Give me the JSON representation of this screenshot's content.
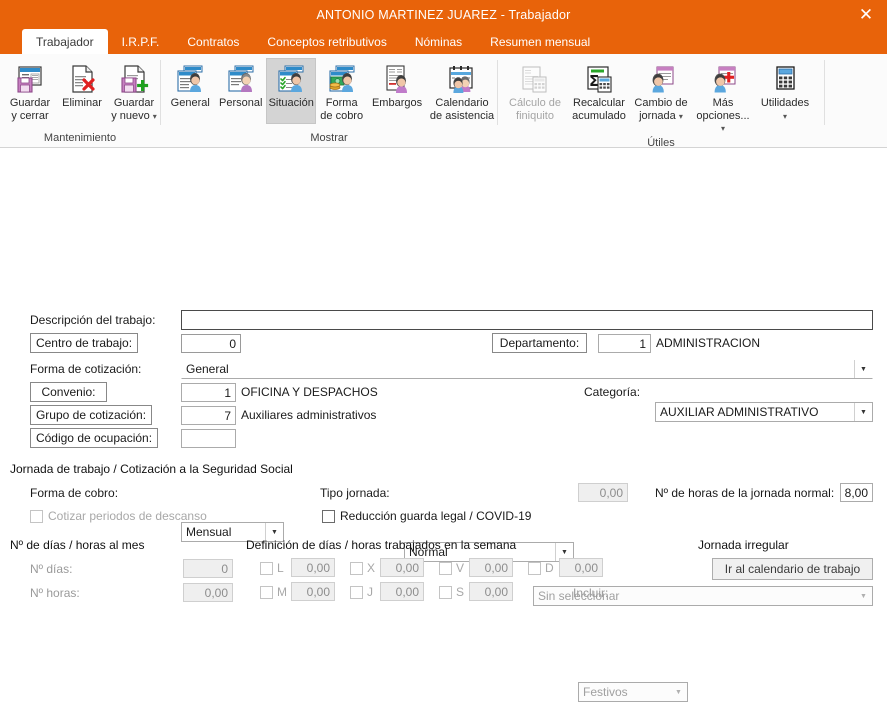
{
  "window": {
    "title": "ANTONIO MARTINEZ JUAREZ - Trabajador",
    "close_icon": "close-icon",
    "accent_color": "#E8630A"
  },
  "tabs": [
    {
      "label": "Trabajador",
      "active": true
    },
    {
      "label": "I.R.P.F.",
      "active": false
    },
    {
      "label": "Contratos",
      "active": false
    },
    {
      "label": "Conceptos retributivos",
      "active": false
    },
    {
      "label": "Nóminas",
      "active": false
    },
    {
      "label": "Resumen mensual",
      "active": false
    }
  ],
  "ribbon": {
    "groups": [
      {
        "label": "Mantenimiento",
        "buttons": [
          {
            "label_line1": "Guardar",
            "label_line2": "y cerrar",
            "icon": "save-close-icon",
            "disabled": false,
            "selected": false,
            "dropdown": false
          },
          {
            "label_line1": "Eliminar",
            "label_line2": "",
            "icon": "delete-document-icon",
            "disabled": false,
            "selected": false,
            "dropdown": false
          },
          {
            "label_line1": "Guardar",
            "label_line2": "y nuevo",
            "icon": "save-new-icon",
            "disabled": false,
            "selected": false,
            "dropdown": true
          }
        ]
      },
      {
        "label": "Mostrar",
        "buttons": [
          {
            "label_line1": "General",
            "label_line2": "",
            "icon": "general-person-icon",
            "disabled": false,
            "selected": false,
            "dropdown": false
          },
          {
            "label_line1": "Personal",
            "label_line2": "",
            "icon": "personal-person-icon",
            "disabled": false,
            "selected": false,
            "dropdown": false
          },
          {
            "label_line1": "Situación",
            "label_line2": "",
            "icon": "situation-person-icon",
            "disabled": false,
            "selected": true,
            "dropdown": false
          },
          {
            "label_line1": "Forma",
            "label_line2": "de cobro",
            "icon": "payment-money-icon",
            "disabled": false,
            "selected": false,
            "dropdown": false
          },
          {
            "label_line1": "Embargos",
            "label_line2": "",
            "icon": "garnishment-icon",
            "disabled": false,
            "selected": false,
            "dropdown": false
          },
          {
            "label_line1": "Calendario",
            "label_line2": "de asistencia",
            "icon": "attendance-calendar-icon",
            "disabled": false,
            "selected": false,
            "dropdown": false
          }
        ]
      },
      {
        "label": "Útiles",
        "buttons": [
          {
            "label_line1": "Cálculo de",
            "label_line2": "finiquito",
            "icon": "settlement-calc-icon",
            "disabled": true,
            "selected": false,
            "dropdown": false
          },
          {
            "label_line1": "Recalcular",
            "label_line2": "acumulado",
            "icon": "recalculate-sum-icon",
            "disabled": false,
            "selected": false,
            "dropdown": false
          },
          {
            "label_line1": "Cambio de",
            "label_line2": "jornada",
            "icon": "change-workday-icon",
            "disabled": false,
            "selected": false,
            "dropdown": true
          },
          {
            "label_line1": "Más",
            "label_line2": "opciones...",
            "icon": "more-options-icon",
            "disabled": false,
            "selected": false,
            "dropdown": true
          },
          {
            "label_line1": "Utilidades",
            "label_line2": "",
            "icon": "utilities-calculator-icon",
            "disabled": false,
            "selected": false,
            "dropdown": true
          }
        ]
      }
    ]
  },
  "form": {
    "descripcion_label": "Descripción del trabajo:",
    "descripcion_value": "",
    "centro_trabajo_button": "Centro de trabajo:",
    "centro_trabajo_value": "0",
    "departamento_button": "Departamento:",
    "departamento_value": "1",
    "departamento_name": "ADMINISTRACION",
    "forma_cotizacion_label": "Forma de cotización:",
    "forma_cotizacion_value": "General",
    "convenio_button": "Convenio:",
    "convenio_value": "1",
    "convenio_name": "OFICINA Y DESPACHOS",
    "categoria_label": "Categoría:",
    "categoria_value": "AUXILIAR ADMINISTRATIVO",
    "grupo_cotizacion_button": "Grupo de cotización:",
    "grupo_cotizacion_value": "7",
    "grupo_cotizacion_name": "Auxiliares administrativos",
    "codigo_ocupacion_button": "Código de ocupación:",
    "codigo_ocupacion_value": ""
  },
  "jornada": {
    "section_title": "Jornada de trabajo / Cotización a la Seguridad Social",
    "forma_cobro_label": "Forma de cobro:",
    "forma_cobro_value": "Mensual",
    "cotizar_descanso_label": "Cotizar periodos de descanso",
    "cotizar_descanso_checked": false,
    "tipo_jornada_label": "Tipo jornada:",
    "tipo_jornada_value": "Normal",
    "tipo_jornada_pct": "0,00",
    "reduccion_label": "Reducción guarda legal / COVID-19",
    "reduccion_checked": false,
    "reduccion_select_value": "Sin seleccionar",
    "horas_normal_label": "Nº de horas de la jornada normal:",
    "horas_normal_value": "8,00"
  },
  "mes": {
    "section_title": "Nº de días / horas al mes",
    "dias_label": "Nº días:",
    "dias_value": "0",
    "horas_label": "Nº horas:",
    "horas_value": "0,00"
  },
  "semana": {
    "section_title": "Definición de días / horas trabajados en la semana",
    "days": [
      {
        "code": "L",
        "value": "0,00",
        "checked": false
      },
      {
        "code": "M",
        "value": "0,00",
        "checked": false
      },
      {
        "code": "X",
        "value": "0,00",
        "checked": false
      },
      {
        "code": "J",
        "value": "0,00",
        "checked": false
      },
      {
        "code": "V",
        "value": "0,00",
        "checked": false
      },
      {
        "code": "S",
        "value": "0,00",
        "checked": false
      },
      {
        "code": "D",
        "value": "0,00",
        "checked": false
      }
    ],
    "incluir_label": "Incluir:",
    "incluir_value": "Festivos"
  },
  "irregular": {
    "section_title": "Jornada irregular",
    "button_label": "Ir al calendario de trabajo"
  }
}
